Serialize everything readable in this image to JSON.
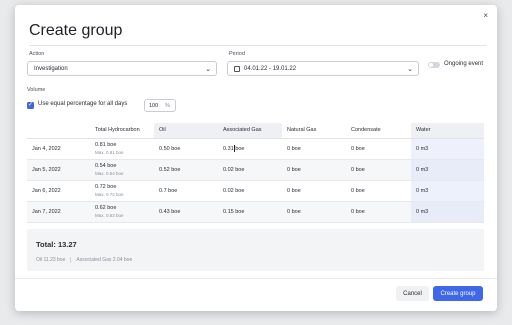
{
  "dialog": {
    "title": "Create group",
    "close_label": "×"
  },
  "form": {
    "action_label": "Action",
    "action_value": "Investigation",
    "period_label": "Period",
    "period_value": "04.01.22 - 19.01.22",
    "ongoing_label": "Ongoing event",
    "ongoing_on": false
  },
  "volume": {
    "label": "Volume",
    "equal_label": "Use equal percentage for all days",
    "equal_checked": true,
    "percent_value": "100",
    "percent_unit": "%"
  },
  "table": {
    "columns": [
      "",
      "Total Hydrocarbon",
      "Oil",
      "Associated Gas",
      "Natural Gas",
      "Condensate",
      "Water"
    ],
    "rows": [
      {
        "date": "Jan 4, 2022",
        "total": "0.81 boe",
        "max": "Max. 0.81 boe",
        "oil": "0.50 boe",
        "assoc_a": "0.31",
        "assoc_b": "boe",
        "natural": "0 boe",
        "cond": "0 boe",
        "water": "0 m3"
      },
      {
        "date": "Jan 5, 2022",
        "total": "0.54 boe",
        "max": "Max. 0.54 boe",
        "oil": "0.52 boe",
        "assoc": "0.02 boe",
        "natural": "0 boe",
        "cond": "0 boe",
        "water": "0 m3"
      },
      {
        "date": "Jan 6, 2022",
        "total": "0.72 boe",
        "max": "Max. 0.72 boe",
        "oil": "0.7 boe",
        "assoc": "0.02 boe",
        "natural": "0 boe",
        "cond": "0 boe",
        "water": "0 m3"
      },
      {
        "date": "Jan 7, 2022",
        "total": "0.62 boe",
        "max": "Max. 0.63 boe",
        "oil": "0.43 boe",
        "assoc": "0.15 boe",
        "natural": "0 boe",
        "cond": "0 boe",
        "water": "0 m3"
      }
    ]
  },
  "summary": {
    "total": "Total: 13.27",
    "oil": "Oil 11.23 boe",
    "assoc": "Associated Gas 2.04 boe"
  },
  "footer": {
    "cancel_label": "Cancel",
    "create_label": "Create group"
  },
  "colors": {
    "accent": "#3f68e8",
    "water_col": "#eef1fb"
  },
  "icons": {
    "close": "close-icon",
    "chevron": "chevron-down-icon",
    "calendar": "calendar-icon",
    "check": "checkmark-icon"
  }
}
